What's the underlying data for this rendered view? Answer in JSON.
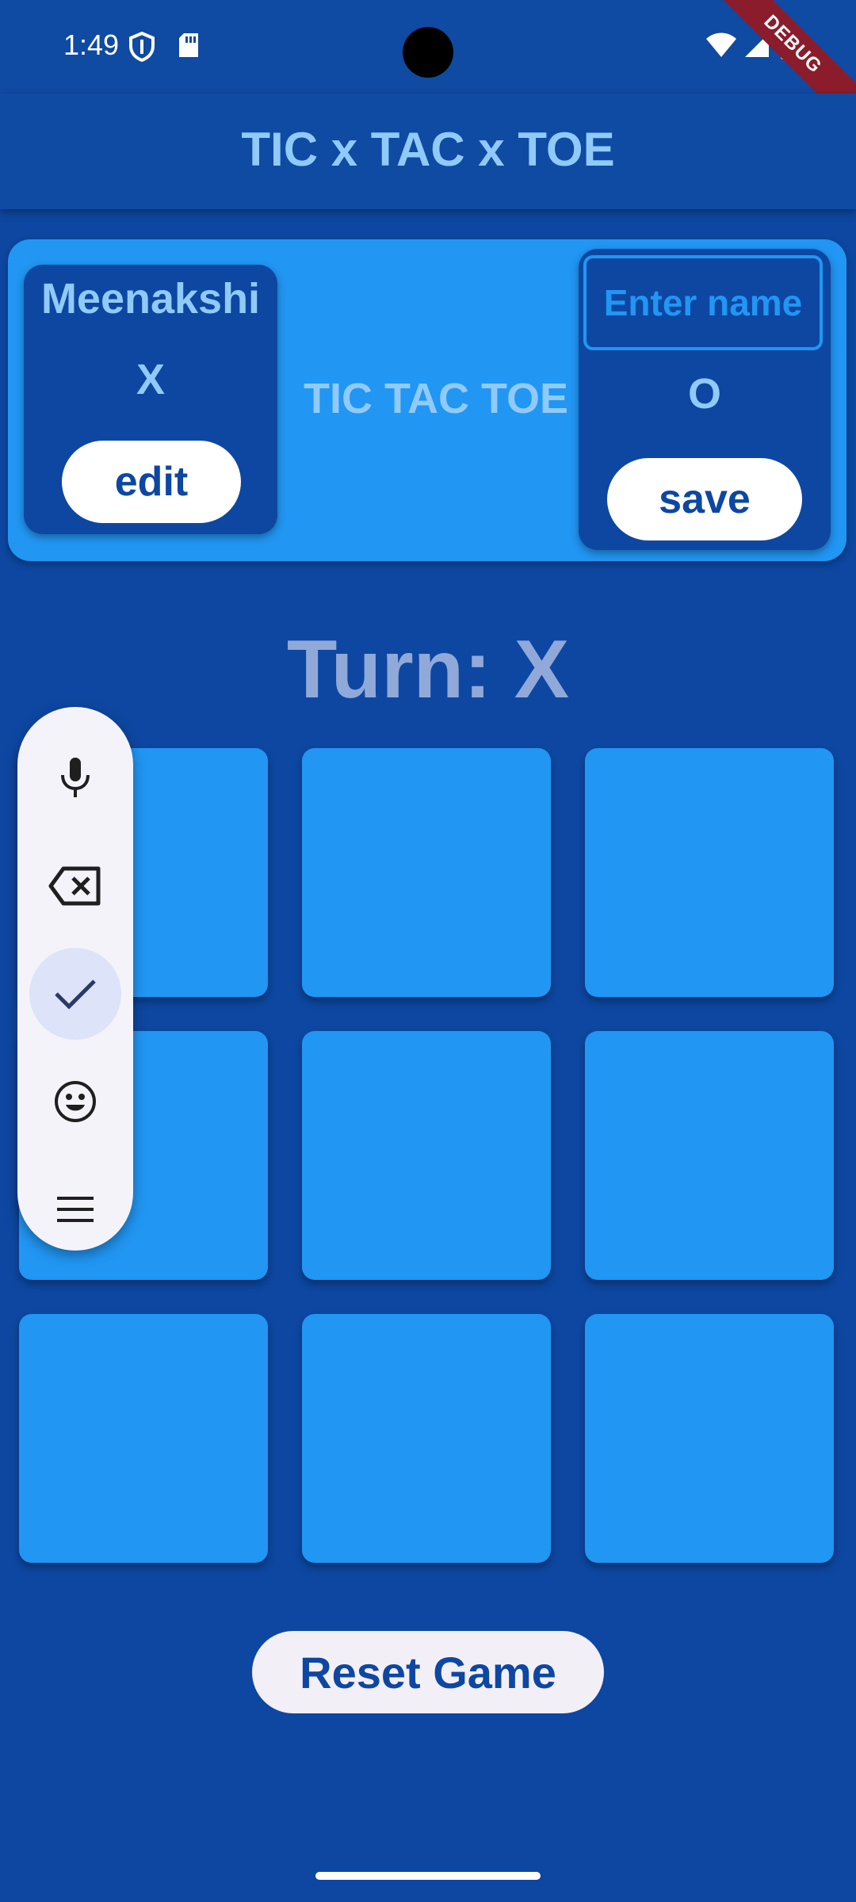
{
  "status_bar": {
    "time": "1:49",
    "icons": [
      "shield-icon",
      "sd-card-icon",
      "wifi-icon",
      "signal-icon",
      "battery-icon"
    ],
    "debug_banner": "DEBUG"
  },
  "app_bar": {
    "title": "TIC x TAC x TOE"
  },
  "header": {
    "center_title": "TIC TAC TOE",
    "player_one": {
      "name": "Meenakshi",
      "symbol": "X",
      "button_label": "edit"
    },
    "player_two": {
      "name_value": "",
      "name_placeholder": "Enter name",
      "symbol": "O",
      "button_label": "save"
    }
  },
  "game": {
    "turn_text": "Turn: X",
    "board": [
      "",
      "",
      "",
      "",
      "",
      "",
      "",
      "",
      ""
    ],
    "reset_label": "Reset Game"
  },
  "ime_toolbar": {
    "buttons": [
      {
        "icon": "microphone-icon",
        "selected": false
      },
      {
        "icon": "backspace-icon",
        "selected": false
      },
      {
        "icon": "checkmark-icon",
        "selected": true
      },
      {
        "icon": "emoji-icon",
        "selected": false
      },
      {
        "icon": "menu-icon",
        "selected": false
      }
    ]
  },
  "colors": {
    "background": "#0D47A1",
    "app_bar": "#0F4AA3",
    "accent": "#2196F3",
    "title_text": "#90CAF9",
    "button_text": "#0D47A1"
  }
}
